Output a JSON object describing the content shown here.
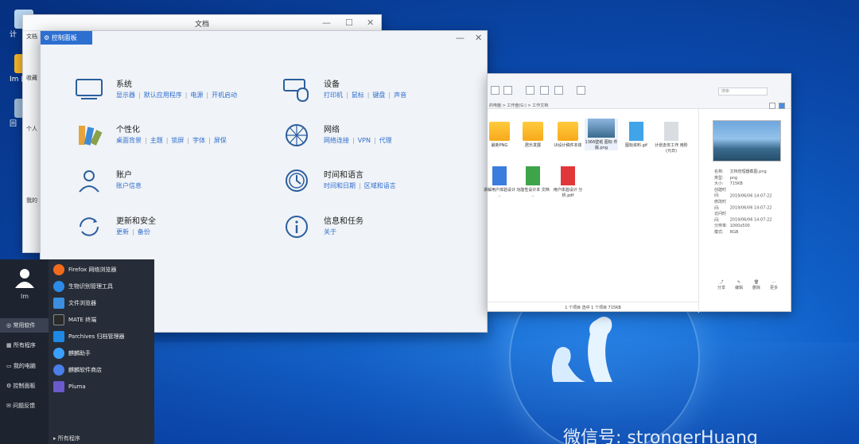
{
  "desktop": {
    "icon_labels": [
      "计",
      "Im 的",
      "回"
    ],
    "watermark": "微信号: strongerHuang"
  },
  "doc_window": {
    "title": "文档",
    "tab": "文档",
    "sidebar": [
      "收藏",
      "个人",
      "我的"
    ]
  },
  "control_panel": {
    "title": "控制面板",
    "categories": [
      {
        "name": "系统",
        "icon": "monitor-icon",
        "links": [
          "显示器",
          "默认应用程序",
          "电源",
          "开机启动"
        ]
      },
      {
        "name": "个性化",
        "icon": "palette-icon",
        "links": [
          "桌面背景",
          "主题",
          "锁屏",
          "字体",
          "屏保"
        ]
      },
      {
        "name": "账户",
        "icon": "user-icon",
        "links": [
          "账户信息"
        ]
      },
      {
        "name": "更新和安全",
        "icon": "refresh-icon",
        "links": [
          "更新",
          "备份"
        ]
      },
      {
        "name": "设备",
        "icon": "keyboard-mouse-icon",
        "links": [
          "打印机",
          "鼠标",
          "键盘",
          "声音"
        ]
      },
      {
        "name": "网络",
        "icon": "network-icon",
        "links": [
          "网络连接",
          "VPN",
          "代理"
        ]
      },
      {
        "name": "时间和语言",
        "icon": "clock-icon",
        "links": [
          "时间和日期",
          "区域和语言"
        ]
      },
      {
        "name": "信息和任务",
        "icon": "info-icon",
        "links": [
          "关于"
        ]
      }
    ]
  },
  "file_manager": {
    "path": "的电脑 > 工作盘(G:) > 工作文档",
    "search_placeholder": "搜索",
    "files": [
      {
        "name": "最新PNG",
        "type": "folder"
      },
      {
        "name": "居乐发展",
        "type": "folder"
      },
      {
        "name": "UI设计稿件本体",
        "type": "folder"
      },
      {
        "name": "1366壁纸 图标 件版.png",
        "type": "image"
      },
      {
        "name": "图标资料.gif",
        "type": "gif"
      },
      {
        "name": "计划去年工作 用阶 (元日)",
        "type": "text"
      },
      {
        "name": "讲解用户体验设计 ..",
        "type": "doc"
      },
      {
        "name": "功能性设计本 文档 ..",
        "type": "xls"
      },
      {
        "name": "用户体验设计 分析.pdf",
        "type": "pdf"
      }
    ],
    "properties": [
      [
        "名称:",
        "文档管理器截图.png"
      ],
      [
        "类型:",
        "png"
      ],
      [
        "大小:",
        "715KB"
      ],
      [
        "创建时间:",
        "2019/06/06 14:07:22"
      ],
      [
        "修改时间:",
        "2019/06/06 14:07:22"
      ],
      [
        "访问时间:",
        "2019/06/06 14:07:22"
      ],
      [
        "分辨率:",
        "1000x500"
      ],
      [
        "模式:",
        "RGB"
      ]
    ],
    "actions": [
      "分享",
      "编辑",
      "删除",
      "更多"
    ],
    "status": "1 个项目  选中 1 个项目  715KB"
  },
  "start_menu": {
    "username": "lm",
    "nav": [
      "常用软件",
      "所有程序",
      "我的电脑",
      "控制面板",
      "问题反馈"
    ],
    "apps": [
      {
        "label": "Firefox 网络浏览器",
        "color": "#f26b1d"
      },
      {
        "label": "生物识别管理工具",
        "color": "#2b8be6"
      },
      {
        "label": "文件浏览器",
        "color": "#3b8fe0"
      },
      {
        "label": "MATE 终端",
        "color": "#2a2a2a"
      },
      {
        "label": "Parchives 归档管理器",
        "color": "#1e88e5"
      },
      {
        "label": "麒麟助手",
        "color": "#3aa0ff"
      },
      {
        "label": "麒麟软件商店",
        "color": "#4a7ee8"
      },
      {
        "label": "Pluma",
        "color": "#6a5acd"
      }
    ],
    "all_programs": "所有程序"
  }
}
